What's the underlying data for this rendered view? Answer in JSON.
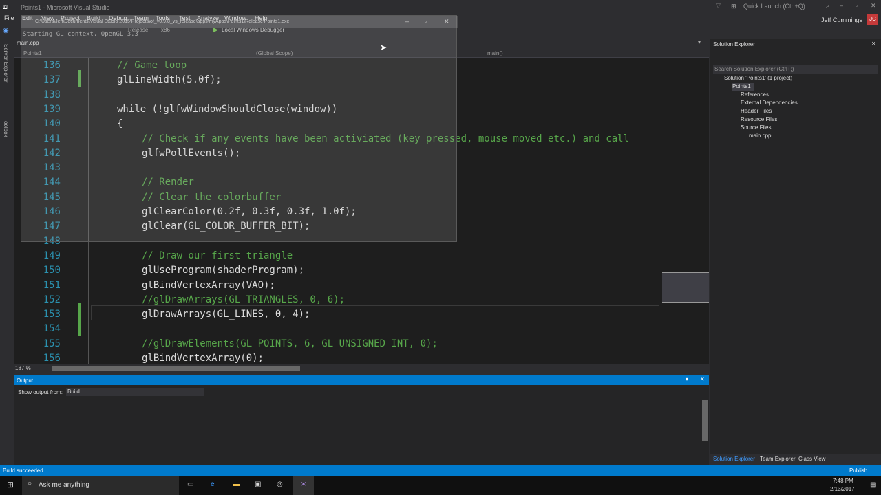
{
  "title": "Points1 - Microsoft Visual Studio",
  "quick_launch_placeholder": "Quick Launch (Ctrl+Q)",
  "user_name": "Jeff Cummings",
  "user_initials": "JC",
  "menu": [
    "File",
    "Edit",
    "View",
    "Project",
    "Build",
    "Debug",
    "Team",
    "Tools",
    "Test",
    "Analyze",
    "Window",
    "Help"
  ],
  "toolbar": {
    "config": "Release",
    "platform": "x86",
    "debugger": "Local Windows Debugger"
  },
  "left_tabs": [
    "Server Explorer",
    "Toolbox"
  ],
  "doc_tab": "main.cpp",
  "nav": {
    "project": "Points1",
    "scope": "(Global Scope)",
    "member": "main()"
  },
  "overlay": {
    "path": "C:\\Users\\Jeff\\Documents\\Visual Studio 2015\\Projects\\of_v0.9.8_vs_release\\apps\\myApps\\Points1\\Release\\Points1.exe",
    "text": "Starting GL context, OpenGL 3.3"
  },
  "code_lines": [
    {
      "n": "136",
      "text": "// Game loop",
      "cls": "cmt",
      "indent": 1
    },
    {
      "n": "137",
      "text": "glLineWidth(5.0f);",
      "cls": "txt",
      "indent": 1
    },
    {
      "n": "138",
      "text": "",
      "cls": "txt",
      "indent": 0
    },
    {
      "n": "139",
      "text": "while (!glfwWindowShouldClose(window))",
      "cls": "txt",
      "indent": 1
    },
    {
      "n": "140",
      "text": "{",
      "cls": "txt",
      "indent": 1
    },
    {
      "n": "141",
      "text": "// Check if any events have been activiated (key pressed, mouse moved etc.) and call",
      "cls": "cmt",
      "indent": 2
    },
    {
      "n": "142",
      "text": "glfwPollEvents();",
      "cls": "txt",
      "indent": 2
    },
    {
      "n": "143",
      "text": "",
      "cls": "txt",
      "indent": 0
    },
    {
      "n": "144",
      "text": "// Render",
      "cls": "cmt",
      "indent": 2
    },
    {
      "n": "145",
      "text": "// Clear the colorbuffer",
      "cls": "cmt",
      "indent": 2
    },
    {
      "n": "146",
      "text": "glClearColor(0.2f, 0.3f, 0.3f, 1.0f);",
      "cls": "txt",
      "indent": 2
    },
    {
      "n": "147",
      "text": "glClear(GL_COLOR_BUFFER_BIT);",
      "cls": "txt",
      "indent": 2
    },
    {
      "n": "148",
      "text": "",
      "cls": "txt",
      "indent": 0
    },
    {
      "n": "149",
      "text": "// Draw our first triangle",
      "cls": "cmt",
      "indent": 2
    },
    {
      "n": "150",
      "text": "glUseProgram(shaderProgram);",
      "cls": "txt",
      "indent": 2
    },
    {
      "n": "151",
      "text": "glBindVertexArray(VAO);",
      "cls": "txt",
      "indent": 2
    },
    {
      "n": "152",
      "text": "//glDrawArrays(GL_TRIANGLES, 0, 6);",
      "cls": "cmt",
      "indent": 2
    },
    {
      "n": "153",
      "text": "glDrawArrays(GL_LINES, 0, 4);",
      "cls": "txt",
      "indent": 2
    },
    {
      "n": "154",
      "text": "",
      "cls": "txt",
      "indent": 0
    },
    {
      "n": "155",
      "text": "//glDrawElements(GL_POINTS, 6, GL_UNSIGNED_INT, 0);",
      "cls": "cmt",
      "indent": 2
    },
    {
      "n": "156",
      "text": "glBindVertexArray(0);",
      "cls": "txt",
      "indent": 2
    }
  ],
  "zoom": "187 %",
  "output": {
    "title": "Output",
    "show_from_label": "Show output from:",
    "source": "Build"
  },
  "solution_explorer": {
    "title": "Solution Explorer",
    "search_placeholder": "Search Solution Explorer (Ctrl+;)",
    "items": [
      {
        "label": "Solution 'Points1' (1 project)",
        "depth": 0
      },
      {
        "label": "Points1",
        "depth": 1
      },
      {
        "label": "References",
        "depth": 2
      },
      {
        "label": "External Dependencies",
        "depth": 2
      },
      {
        "label": "Header Files",
        "depth": 2
      },
      {
        "label": "Resource Files",
        "depth": 2
      },
      {
        "label": "Source Files",
        "depth": 2
      },
      {
        "label": "main.cpp",
        "depth": 3
      }
    ],
    "bottom_tabs": [
      "Solution Explorer",
      "Team Explorer",
      "Class View"
    ]
  },
  "status": {
    "left": "Build succeeded",
    "right": "Publish"
  },
  "taskbar": {
    "search": "Ask me anything",
    "time": "7:48 PM",
    "date": "2/13/2017"
  }
}
